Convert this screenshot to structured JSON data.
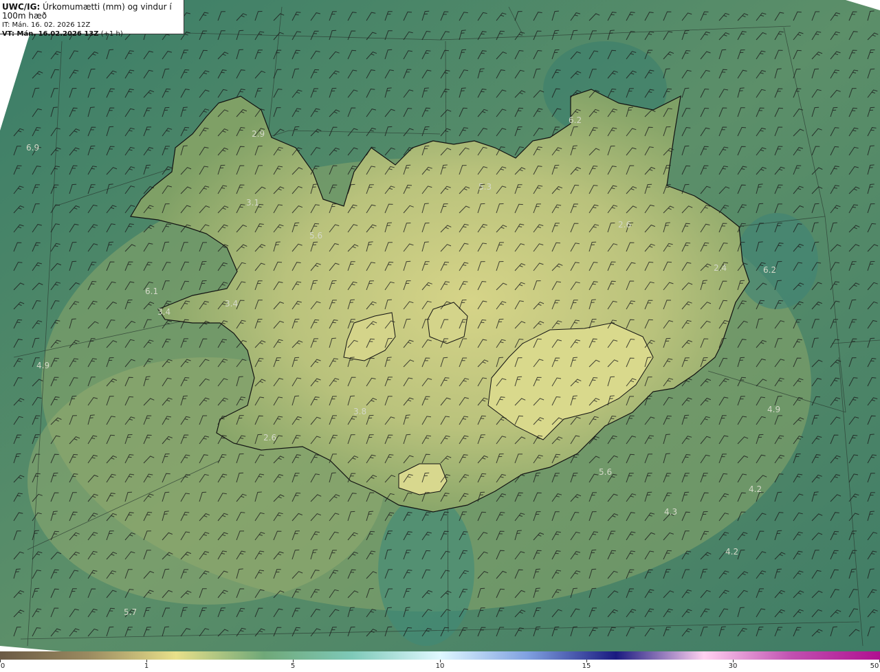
{
  "header": {
    "code": "UWC/IG:",
    "title": "Úrkomumætti (mm) og vindur í 100m hæð",
    "init_time": "IT: Mán. 16. 02. 2026 12Z",
    "valid_prefix": "VT: Mán. 16.02.2026 13Z",
    "valid_suffix": "(+1 h)"
  },
  "colors": {
    "sea_dark": "#2f6f5f",
    "sea_mid": "#4a8a6e",
    "land_low": "#6f9a62",
    "land_high": "#d8d68a",
    "coast": "#111111",
    "barb": "#1a1a1a"
  },
  "map_labels": [
    {
      "text": "6.9"
    },
    {
      "text": "2.9"
    },
    {
      "text": "3.1"
    },
    {
      "text": "5.6"
    },
    {
      "text": "6.2"
    },
    {
      "text": "5.3"
    },
    {
      "text": "2.6"
    },
    {
      "text": "2.4"
    },
    {
      "text": "6.2"
    },
    {
      "text": "6.1"
    },
    {
      "text": "3.4"
    },
    {
      "text": "3.4"
    },
    {
      "text": "4.9"
    },
    {
      "text": "3.8"
    },
    {
      "text": "2.6"
    },
    {
      "text": "4.9"
    },
    {
      "text": "5.6"
    },
    {
      "text": "4.2"
    },
    {
      "text": "4.3"
    },
    {
      "text": "4.2"
    },
    {
      "text": "5.7"
    }
  ],
  "colorbar": {
    "ticks": [
      {
        "label": "0",
        "value": 0
      },
      {
        "label": "1",
        "value": 1
      },
      {
        "label": "5",
        "value": 5
      },
      {
        "label": "10",
        "value": 10
      },
      {
        "label": "15",
        "value": 15
      },
      {
        "label": "30",
        "value": 30
      },
      {
        "label": "50",
        "value": 50
      }
    ],
    "stops": [
      "#6b5a45",
      "#9a8a60",
      "#e8e08a",
      "#6fa878",
      "#7ec9b8",
      "#dff8ff",
      "#7fa0e0",
      "#1a1a80",
      "#ffd0f0",
      "#c050b0",
      "#b01090"
    ]
  }
}
